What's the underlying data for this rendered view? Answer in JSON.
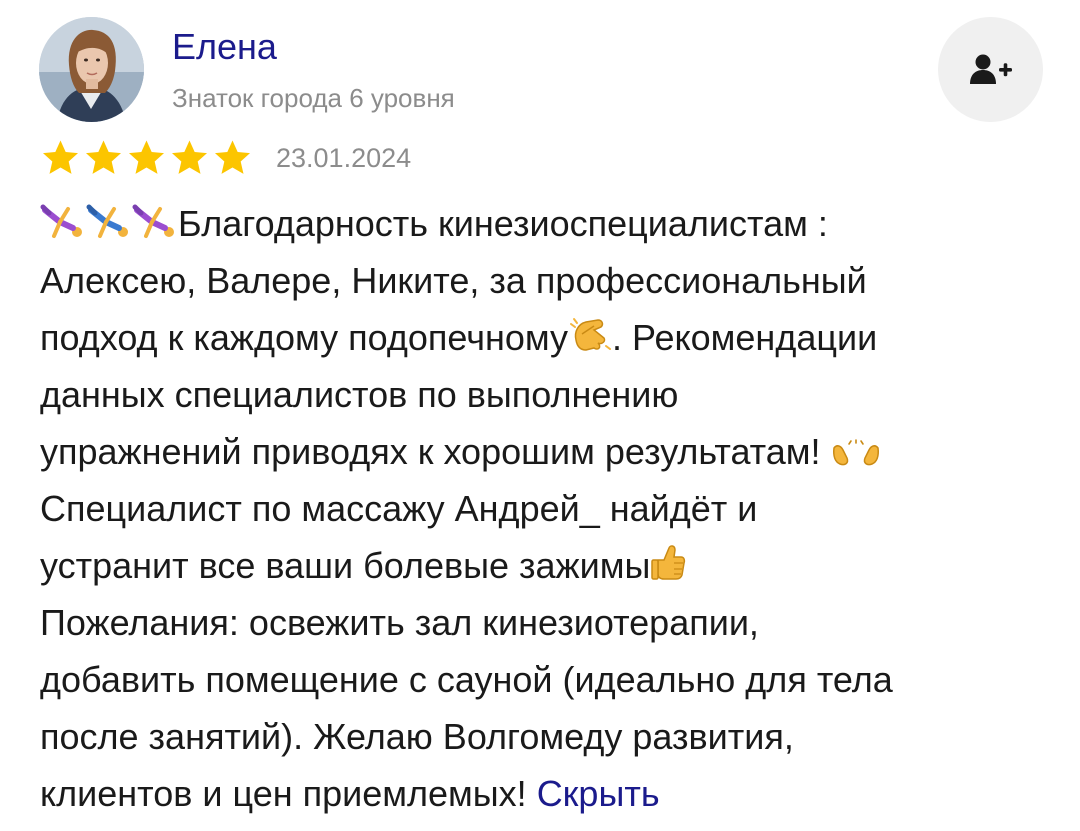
{
  "author": {
    "name": "Елена",
    "level": "Знаток города 6 уровня"
  },
  "subscribe": {
    "icon": "add-user-icon"
  },
  "rating": {
    "stars": 5,
    "max": 5,
    "color": "#fcc500"
  },
  "date": "23.01.2024",
  "review": {
    "lines": [
      "Благодарность кинезиоспециалистам :",
      "Алексею, Валере, Никите, за профессиональный",
      "подход к каждому подопечному",
      ". Рекомендации",
      "данных специалистов по выполнению",
      "упражнений приводях к хорошим результатам! ",
      "Специалист по массажу Андрей_ найдёт и",
      "устранит все ваши болевые зажимы",
      "Пожелания: освежить зал кинезиотерапии,",
      "добавить помещение с сауной (идеально для тела",
      "после занятий). Желаю Волгомеду развития,",
      "клиентов и цен приемлемых! "
    ],
    "collapse_label": "Скрыть",
    "emojis": {
      "gymnast": "person-cartwheeling-emoji",
      "clap": "clapping-hands-emoji",
      "open_hands": "open-hands-emoji",
      "thumbs": "thumbs-up-emoji"
    }
  },
  "colors": {
    "link": "#1b1b8c",
    "muted": "#8c8c8c",
    "button_bg": "#f0f0f0",
    "star": "#fcc500"
  }
}
